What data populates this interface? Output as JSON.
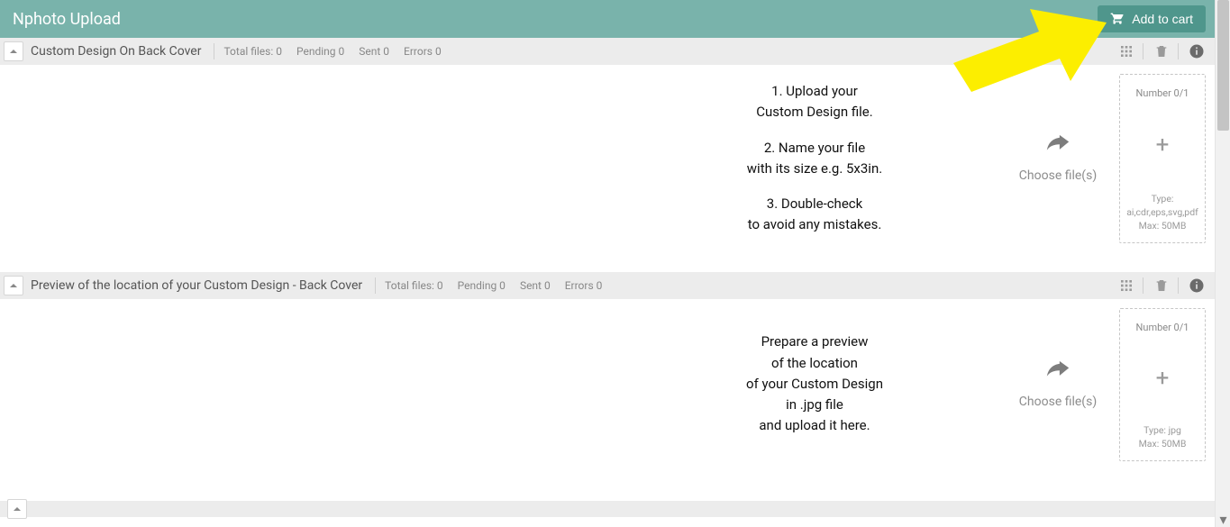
{
  "header": {
    "title": "Nphoto Upload",
    "cart_label": "Add to cart"
  },
  "sections": [
    {
      "title": "Custom Design On Back Cover",
      "stats": {
        "total": "Total files: 0",
        "pending": "Pending 0",
        "sent": "Sent 0",
        "errors": "Errors 0"
      },
      "instructions": [
        "1. Upload your",
        "Custom Design file.",
        "",
        "2. Name your file",
        "with its size e.g. 5x3in.",
        "",
        "3. Double-check",
        "to avoid any mistakes."
      ],
      "choose_label": "Choose file(s)",
      "drop": {
        "number": "Number 0/1",
        "type_label": "Type:",
        "types": "ai,cdr,eps,svg,pdf",
        "max": "Max: 50MB"
      }
    },
    {
      "title": "Preview of the location of your Custom Design - Back Cover",
      "stats": {
        "total": "Total files: 0",
        "pending": "Pending 0",
        "sent": "Sent 0",
        "errors": "Errors 0"
      },
      "instructions": [
        "Prepare a preview",
        "of the location",
        "of your Custom Design",
        "in .jpg file",
        "and upload it here."
      ],
      "choose_label": "Choose file(s)",
      "drop": {
        "number": "Number 0/1",
        "type_label": "Type: jpg",
        "types": "",
        "max": "Max: 50MB"
      }
    }
  ],
  "icons": {
    "grid": "grid-icon",
    "trash": "trash-icon",
    "info": "info-icon",
    "share": "share-arrow-icon",
    "plus": "+"
  },
  "colors": {
    "brand": "#79b3ab",
    "brand_dark": "#4f968c",
    "arrow": "#fcee00"
  }
}
